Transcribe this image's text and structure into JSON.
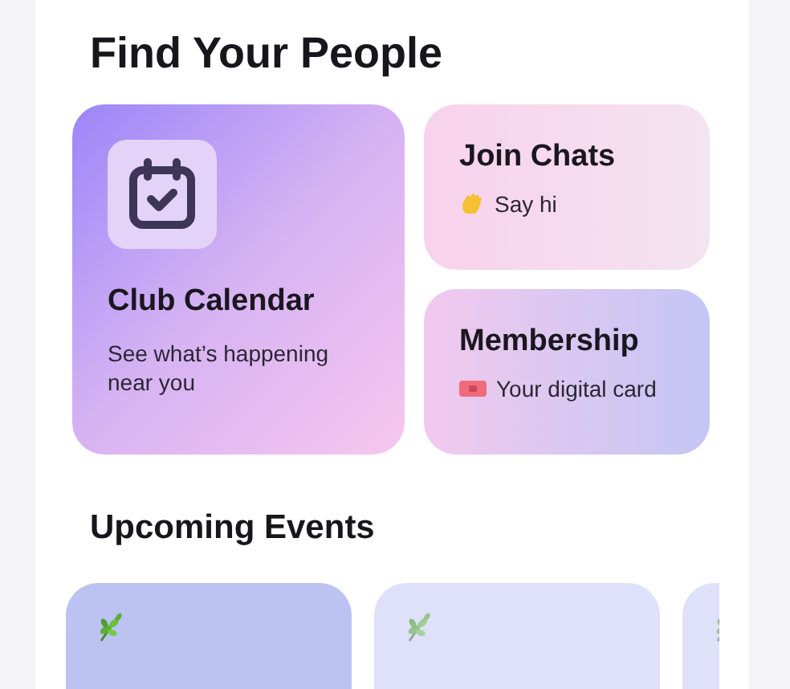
{
  "title": "Find Your People",
  "cards": [
    {
      "kind": "feature",
      "title": "Club Calendar",
      "subtitle": "See what’s happening near you"
    },
    {
      "kind": "chat",
      "title": "Join Chats",
      "subtitle": "Say hi"
    },
    {
      "kind": "membership",
      "title": "Membership",
      "subtitle": "Your digital card"
    }
  ],
  "events_heading": "Upcoming Events",
  "events": [
    {
      "selected": true
    },
    {
      "selected": false
    },
    {
      "selected": false
    }
  ]
}
